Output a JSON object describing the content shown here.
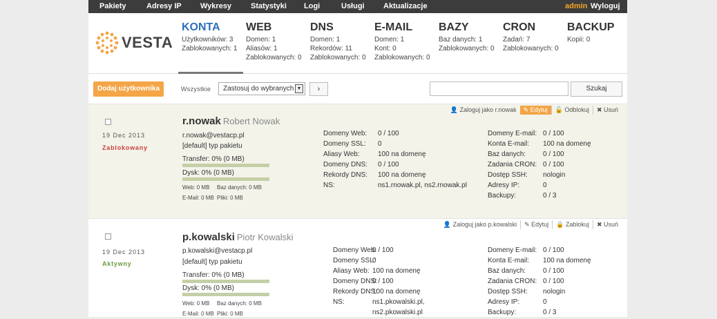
{
  "topnav": {
    "items": [
      "Pakiety",
      "Adresy IP",
      "Wykresy",
      "Statystyki",
      "Logi",
      "Usługi",
      "Aktualizacje"
    ],
    "user": "admin",
    "logout": "Wyloguj"
  },
  "logo": {
    "text": "VESTA"
  },
  "sections": [
    {
      "title": "KONTA",
      "lines": [
        "Użytkowników: 3",
        "Zablokowanych: 1"
      ]
    },
    {
      "title": "WEB",
      "lines": [
        "Domen: 1",
        "Aliasów: 1",
        "Zablokowanych: 0"
      ]
    },
    {
      "title": "DNS",
      "lines": [
        "Domen: 1",
        "Rekordów: 11",
        "Zablokowanych: 0"
      ]
    },
    {
      "title": "E-MAIL",
      "lines": [
        "Domen: 1",
        "Kont: 0",
        "Zablokowanych: 0"
      ]
    },
    {
      "title": "BAZY",
      "lines": [
        "Baz danych: 1",
        "Zablokowanych: 0"
      ]
    },
    {
      "title": "CRON",
      "lines": [
        "Zadań: 7",
        "Zablokowanych: 0"
      ]
    },
    {
      "title": "BACKUP",
      "lines": [
        "Kopii: 0"
      ]
    }
  ],
  "toolbar": {
    "add_label": "Dodaj użytkownika",
    "all_label": "Wszystkie",
    "bulk_select": "Zastosuj do wybranych",
    "apply": "›",
    "search_value": "",
    "search_label": "Szukaj"
  },
  "colors": {
    "accent": "#f3a547",
    "active_section": "#2c6fb7",
    "blocked": "#c8413a",
    "active": "#6a9a3b",
    "topbar": "#3c3c3c"
  },
  "users": [
    {
      "actions": [
        "Zaloguj jako r.nowak",
        "Edytuj",
        "Odblokuj",
        "Usuń"
      ],
      "date": "19 Dec 2013",
      "status": "Zablokowany",
      "login": "r.nowak",
      "fullname": "Robert Nowak",
      "email": "r.nowak@vestacp.pl",
      "package": "[default] typ pakietu",
      "transfer": "Transfer: 0% (0 MB)",
      "transfer_pct": 0,
      "disk": "Dysk: 0% (0 MB)",
      "disk_pct": 0,
      "usage": [
        "Web: 0 MB",
        "Baz danych: 0 MB",
        "E-Mail: 0 MB",
        "Pliki: 0 MB"
      ],
      "stats_mid": [
        [
          "Domeny Web:",
          "0 / 100"
        ],
        [
          "Domeny SSL:",
          "0"
        ],
        [
          "Aliasy Web:",
          "100 na domenę"
        ],
        [
          "Domeny DNS:",
          "0 / 100"
        ],
        [
          "Rekordy DNS:",
          "100 na domenę"
        ],
        [
          "NS:",
          "ns1.rnowak.pl, ns2.rnowak.pl"
        ]
      ],
      "stats_right": [
        [
          "Domeny E-mail:",
          "0 / 100"
        ],
        [
          "Konta E-mail:",
          "100 na domenę"
        ],
        [
          "Baz danych:",
          "0 / 100"
        ],
        [
          "Zadania CRON:",
          "0 / 100"
        ],
        [
          "Dostęp SSH:",
          "nologin"
        ],
        [
          "Adresy IP:",
          "0"
        ],
        [
          "Backupy:",
          "0 / 3"
        ]
      ]
    },
    {
      "actions": [
        "Zaloguj jako p.kowalski",
        "Edytuj",
        "Zablokuj",
        "Usuń"
      ],
      "date": "19 Dec 2013",
      "status": "Aktywny",
      "login": "p.kowalski",
      "fullname": "Piotr Kowalski",
      "email": "p.kowalski@vestacp.pl",
      "package": "[default] typ pakietu",
      "transfer": "Transfer: 0% (0 MB)",
      "transfer_pct": 0,
      "disk": "Dysk: 0% (0 MB)",
      "disk_pct": 0,
      "usage": [
        "Web: 0 MB",
        "Baz danych: 0 MB",
        "E-Mail: 0 MB",
        "Pliki: 0 MB"
      ],
      "stats_mid": [
        [
          "Domeny Web:",
          "0 / 100"
        ],
        [
          "Domeny SSL:",
          "0"
        ],
        [
          "Aliasy Web:",
          "100 na domenę"
        ],
        [
          "Domeny DNS:",
          "0 / 100"
        ],
        [
          "Rekordy DNS:",
          "100 na domenę"
        ],
        [
          "NS:",
          "ns1.pkowalski.pl,"
        ],
        [
          "",
          "ns2.pkowalski.pl"
        ]
      ],
      "stats_right": [
        [
          "Domeny E-mail:",
          "0 / 100"
        ],
        [
          "Konta E-mail:",
          "100 na domenę"
        ],
        [
          "Baz danych:",
          "0 / 100"
        ],
        [
          "Zadania CRON:",
          "0 / 100"
        ],
        [
          "Dostęp SSH:",
          "nologin"
        ],
        [
          "Adresy IP:",
          "0"
        ],
        [
          "Backupy:",
          "0 / 3"
        ]
      ]
    }
  ]
}
